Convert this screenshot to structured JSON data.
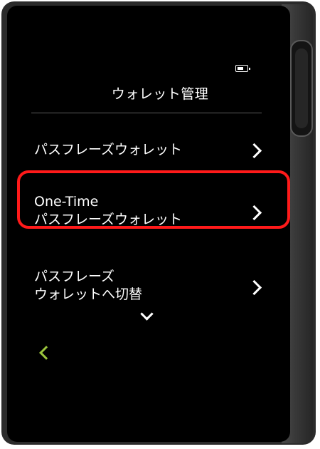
{
  "header": {
    "title": "ウォレット管理",
    "battery_icon": "battery-icon"
  },
  "menu": {
    "items": [
      {
        "line1": "パスフレーズウォレット",
        "line2": ""
      },
      {
        "line1": "One-Time",
        "line2": "パスフレーズウォレット"
      },
      {
        "line1": "パスフレーズ",
        "line2": "ウォレットへ切替"
      }
    ],
    "more_icon": "chevron-down-icon"
  },
  "footer": {
    "back_icon": "back-chevron-icon",
    "back_color": "#9bc53d"
  },
  "annotation": {
    "highlight_color": "#ff1a1a"
  }
}
